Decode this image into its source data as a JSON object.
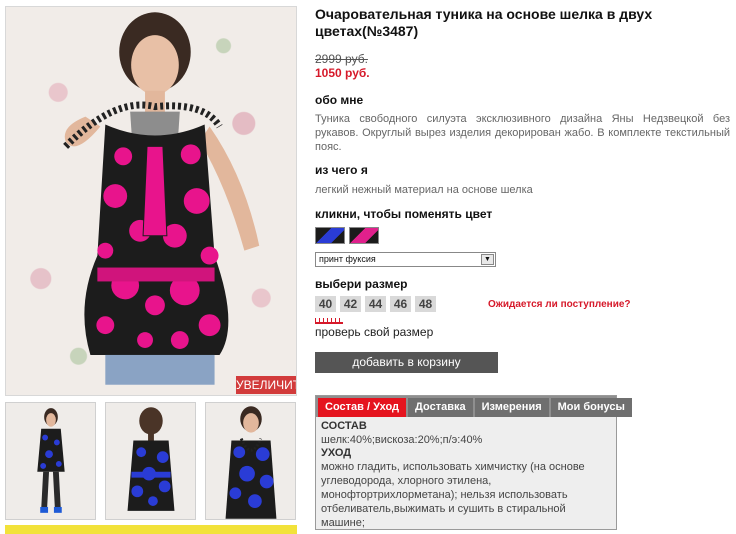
{
  "product": {
    "title": "Очаровательная туника на основе шелка в двух цветах(№3487)",
    "old_price": "2999 руб.",
    "new_price": "1050 руб."
  },
  "about": {
    "heading": "обо мне",
    "text": "Туника свободного силуэта эксклюзивного дизайна Яны Недзвецкой без рукавов. Округлый вырез изделия декорирован жабо. В комплекте текстильный пояс."
  },
  "material": {
    "heading": "из чего я",
    "text": "легкий нежный материал на основе шелка"
  },
  "color": {
    "heading": "кликни, чтобы поменять цвет",
    "swatches": [
      {
        "name": "blue",
        "color": "#2a3cd6"
      },
      {
        "name": "fuchsia",
        "color": "#e0208c"
      }
    ],
    "selected": "принт фуксия"
  },
  "size": {
    "heading": "выбери размер",
    "options": [
      "40",
      "42",
      "44",
      "46",
      "48"
    ],
    "awaiting_link": "Ожидается ли поступление?",
    "check_link": "проверь свой размер"
  },
  "cart_button": "добавить в корзину",
  "zoom_button": "УВЕЛИЧИТЬ",
  "tabs": {
    "items": [
      "Состав / Уход",
      "Доставка",
      "Измерения",
      "Мои бонусы"
    ],
    "active": "Состав / Уход",
    "content": {
      "composition_heading": "СОСТАВ",
      "composition_text": "шелк:40%;вискоза:20%;п/э:40%",
      "care_heading": "УХОД",
      "care_text": "можно гладить, использовать химчистку (на основе углеводорода, хлорного этилена, монофтортрихлорметана); нельзя использовать отбеливатель,выжимать и сушить в стиральной машине;"
    }
  },
  "colors": {
    "accent_red": "#d6192a",
    "tab_active": "#e5141f",
    "print_fuchsia": "#e0208c",
    "print_blue": "#2a3cd6"
  }
}
